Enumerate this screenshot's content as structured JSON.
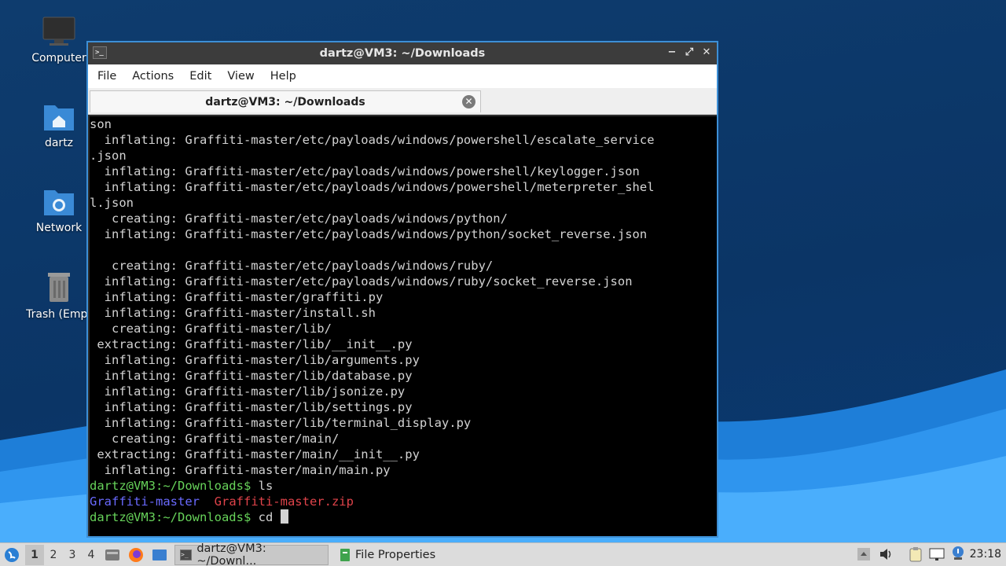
{
  "desktop": {
    "icons": [
      {
        "label": "Computer"
      },
      {
        "label": "dartz"
      },
      {
        "label": "Network"
      },
      {
        "label": "Trash (Empt"
      }
    ]
  },
  "window": {
    "title": "dartz@VM3: ~/Downloads",
    "menu": [
      "File",
      "Actions",
      "Edit",
      "View",
      "Help"
    ],
    "tab_title": "dartz@VM3: ~/Downloads",
    "controls": {
      "minimize": "−",
      "maximize": "⤢",
      "close": "✕"
    }
  },
  "terminal": {
    "lines": [
      "son",
      "  inflating: Graffiti-master/etc/payloads/windows/powershell/escalate_service",
      ".json",
      "  inflating: Graffiti-master/etc/payloads/windows/powershell/keylogger.json",
      "  inflating: Graffiti-master/etc/payloads/windows/powershell/meterpreter_shel",
      "l.json",
      "   creating: Graffiti-master/etc/payloads/windows/python/",
      "  inflating: Graffiti-master/etc/payloads/windows/python/socket_reverse.json",
      "",
      "   creating: Graffiti-master/etc/payloads/windows/ruby/",
      "  inflating: Graffiti-master/etc/payloads/windows/ruby/socket_reverse.json",
      "  inflating: Graffiti-master/graffiti.py",
      "  inflating: Graffiti-master/install.sh",
      "   creating: Graffiti-master/lib/",
      " extracting: Graffiti-master/lib/__init__.py",
      "  inflating: Graffiti-master/lib/arguments.py",
      "  inflating: Graffiti-master/lib/database.py",
      "  inflating: Graffiti-master/lib/jsonize.py",
      "  inflating: Graffiti-master/lib/settings.py",
      "  inflating: Graffiti-master/lib/terminal_display.py",
      "   creating: Graffiti-master/main/",
      " extracting: Graffiti-master/main/__init__.py",
      "  inflating: Graffiti-master/main/main.py"
    ],
    "prompt1": "dartz@VM3:~/Downloads$",
    "cmd1": " ls",
    "ls_dir": "Graffiti-master",
    "ls_sep": "  ",
    "ls_zip": "Graffiti-master.zip",
    "prompt2": "dartz@VM3:~/Downloads$",
    "cmd2": " cd "
  },
  "taskbar": {
    "workspaces": [
      "1",
      "2",
      "3",
      "4"
    ],
    "tasks": [
      {
        "label": "dartz@VM3: ~/Downl..."
      },
      {
        "label": "File Properties"
      }
    ],
    "clock": "23:18"
  },
  "colors": {
    "accent": "#3d8fd6",
    "prompt": "#67d35a",
    "dir": "#6a6aff",
    "archive": "#e0434a"
  }
}
